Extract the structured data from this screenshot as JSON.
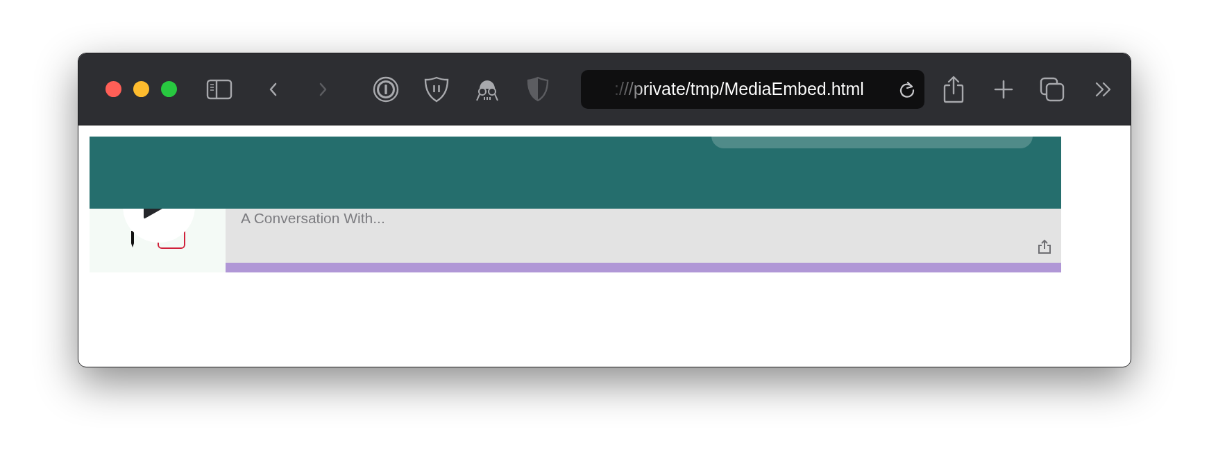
{
  "toolbar": {
    "nav_buttons": [
      {
        "kind": "back",
        "disabled": false
      },
      {
        "kind": "forward",
        "disabled": true
      }
    ],
    "address": ":///private/tmp/MediaEmbed.html"
  },
  "player": {
    "title": "A Conversation With..."
  }
}
